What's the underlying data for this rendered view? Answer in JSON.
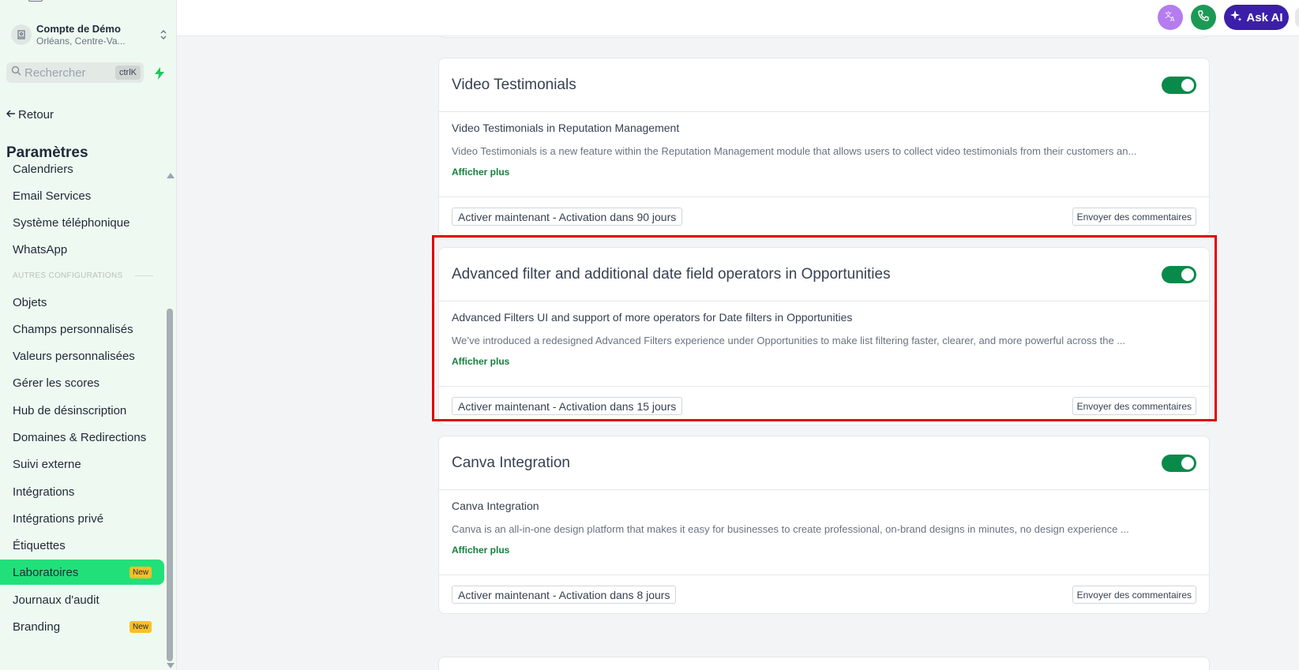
{
  "account": {
    "name": "Compte de Démo",
    "location": "Orléans, Centre-Va..."
  },
  "search": {
    "placeholder": "Rechercher",
    "shortcut": "ctrlK"
  },
  "nav": {
    "back_label": "Retour",
    "section_title": "Paramètres",
    "items": [
      {
        "label": "Calendriers"
      },
      {
        "label": "Email Services"
      },
      {
        "label": "Système téléphonique"
      },
      {
        "label": "WhatsApp"
      }
    ],
    "other_section_label": "AUTRES CONFIGURATIONS",
    "other_items": [
      {
        "label": "Objets"
      },
      {
        "label": "Champs personnalisés"
      },
      {
        "label": "Valeurs personnalisées"
      },
      {
        "label": "Gérer les scores"
      },
      {
        "label": "Hub de désinscription"
      },
      {
        "label": "Domaines & Redirections"
      },
      {
        "label": "Suivi externe"
      },
      {
        "label": "Intégrations"
      },
      {
        "label": "Intégrations privé"
      },
      {
        "label": "Étiquettes"
      },
      {
        "label": "Laboratoires",
        "badge": "New",
        "active": true
      },
      {
        "label": "Journaux d'audit"
      },
      {
        "label": "Branding",
        "badge": "New"
      }
    ]
  },
  "header": {
    "ask_ai_label": "Ask AI"
  },
  "cards": [
    {
      "title": "Video Testimonials",
      "enabled": true,
      "subtitle": "Video Testimonials in Reputation Management",
      "description": "Video Testimonials is a new feature within the Reputation Management module that allows users to collect video testimonials from their customers an...",
      "more_label": "Afficher plus",
      "activate_label": "Activer maintenant - Activation dans 90 jours",
      "feedback_label": "Envoyer des commentaires"
    },
    {
      "title": "Advanced filter and additional date field operators in Opportunities",
      "enabled": true,
      "subtitle": "Advanced Filters UI and support of more operators for Date filters in Opportunities",
      "description": "We’ve introduced a redesigned Advanced Filters experience under Opportunities to make list filtering faster, clearer, and more powerful across the ...",
      "more_label": "Afficher plus",
      "activate_label": "Activer maintenant - Activation dans 15 jours",
      "feedback_label": "Envoyer des commentaires"
    },
    {
      "title": "Canva Integration",
      "enabled": true,
      "subtitle": "Canva Integration",
      "description": "Canva is an all-in-one design platform that makes it easy for businesses to create professional, on-brand designs in minutes, no design experience ...",
      "more_label": "Afficher plus",
      "activate_label": "Activer maintenant - Activation dans 8 jours",
      "feedback_label": "Envoyer des commentaires"
    }
  ],
  "colors": {
    "sidebar_bg": "#eefaf1",
    "active_item": "#21e07a",
    "toggle_on": "#0a8a4a",
    "link_green": "#15803d",
    "highlight_border": "#e00000",
    "ask_ai_bg": "#3b1fa8",
    "badge_bg": "#fbbf24"
  }
}
